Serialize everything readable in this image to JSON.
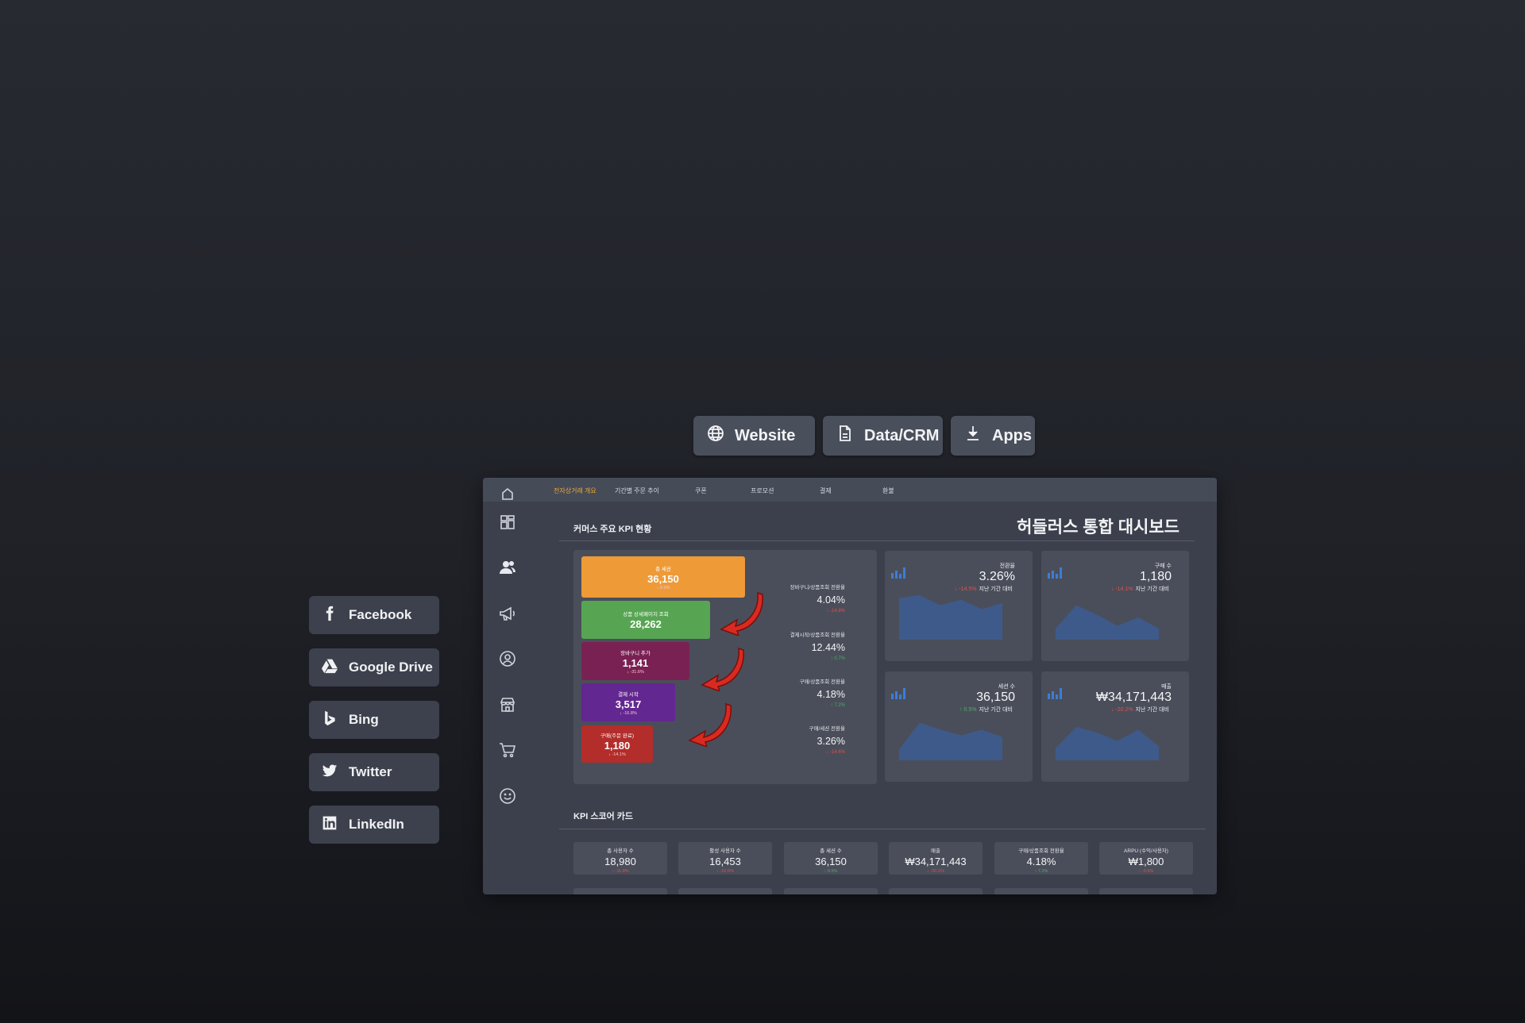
{
  "source_buttons": [
    {
      "label": "Website",
      "icon": "globe-icon"
    },
    {
      "label": "Data/CRM",
      "icon": "document-icon"
    },
    {
      "label": "Apps",
      "icon": "download-icon"
    }
  ],
  "share_buttons": [
    {
      "label": "Facebook",
      "icon": "facebook-icon"
    },
    {
      "label": "Google Drive",
      "icon": "google-drive-icon"
    },
    {
      "label": "Bing",
      "icon": "bing-icon"
    },
    {
      "label": "Twitter",
      "icon": "twitter-icon"
    },
    {
      "label": "LinkedIn",
      "icon": "linkedin-icon"
    }
  ],
  "dashboard": {
    "title": "허들러스 통합 대시보드",
    "top_tabs": [
      "전자상거래 개요",
      "기간별 주문 추이",
      "쿠폰",
      "프로모션",
      "결제",
      "환불"
    ],
    "active_tab": "전자상거래 개요",
    "kpi_section_title": "커머스 주요 KPI 현황",
    "funnel": [
      {
        "label": "총 세션",
        "value": "36,150",
        "delta": "↓ 0.5%",
        "color": "#ee9a37"
      },
      {
        "label": "상품 상세페이지 조회",
        "value": "28,262",
        "delta": "",
        "color": "#57a553"
      },
      {
        "label": "장바구니 추가",
        "value": "1,141",
        "delta": "↓ -31.6%",
        "color": "#7a2153"
      },
      {
        "label": "결제 시작",
        "value": "3,517",
        "delta": "↓ -16.8%",
        "color": "#632791"
      },
      {
        "label": "구매(주문 완료)",
        "value": "1,180",
        "delta": "↓ -14.1%",
        "color": "#b32d2b"
      }
    ],
    "rates": [
      {
        "label": "장바구니/상품조회 전환율",
        "value": "4.04%",
        "delta": "↓ -14.8%",
        "trend": "neg"
      },
      {
        "label": "결제시작/상품조회 전환율",
        "value": "12.44%",
        "delta": "↑ 0.7%",
        "trend": "pos"
      },
      {
        "label": "구매/상품조회 전환율",
        "value": "4.18%",
        "delta": "↑ 7.2%",
        "trend": "pos"
      },
      {
        "label": "구매/세션 전환율",
        "value": "3.26%",
        "delta": "↓ -14.6%",
        "trend": "neg"
      }
    ],
    "kpi_cards": [
      {
        "label": "전환율",
        "value": "3.26%",
        "delta": "↓ -14.5%",
        "trend": "neg",
        "sub": "지난 기간 대비",
        "series": [
          0.75,
          0.8,
          0.62,
          0.72,
          0.55,
          0.66
        ]
      },
      {
        "label": "구매 수",
        "value": "1,180",
        "delta": "↓ -14.1%",
        "trend": "neg",
        "sub": "지난 기간 대비",
        "series": [
          0.2,
          0.62,
          0.45,
          0.25,
          0.4,
          0.2
        ]
      },
      {
        "label": "세션 수",
        "value": "36,150",
        "delta": "↑ 0.5%",
        "trend": "pos",
        "sub": "지난 기간 대비",
        "series": [
          0.2,
          0.68,
          0.55,
          0.45,
          0.55,
          0.42
        ]
      },
      {
        "label": "매출",
        "value": "₩34,171,443",
        "delta": "↓ -20.2%",
        "trend": "neg",
        "sub": "지난 기간 대비",
        "series": [
          0.22,
          0.6,
          0.5,
          0.35,
          0.55,
          0.25
        ]
      }
    ],
    "score_section_title": "KPI 스코어 카드",
    "score_cards": [
      {
        "label": "총 사용자 수",
        "value": "18,980",
        "delta": "↓ -11.8%",
        "trend": "neg"
      },
      {
        "label": "활성 사용자 수",
        "value": "16,453",
        "delta": "↓ -10.6%",
        "trend": "neg"
      },
      {
        "label": "총 세션 수",
        "value": "36,150",
        "delta": "↑ 0.5%",
        "trend": "pos"
      },
      {
        "label": "매출",
        "value": "₩34,171,443",
        "delta": "↓ -20.2%",
        "trend": "neg"
      },
      {
        "label": "구매/상품조회 전환율",
        "value": "4.18%",
        "delta": "↑ 7.2%",
        "trend": "pos"
      },
      {
        "label": "ARPU (수익/사용자)",
        "value": "₩1,800",
        "delta": "↓ -9.5%",
        "trend": "neg"
      }
    ],
    "sidebar_icons": [
      "home-icon",
      "dashboard-grid-icon",
      "users-icon",
      "megaphone-icon",
      "user-circle-icon",
      "store-icon",
      "cart-icon",
      "smile-icon"
    ]
  },
  "colors": {
    "accent": "#f0a836",
    "negative": "#e0504b",
    "positive": "#4caf63",
    "area_fill": "#3e5a8a",
    "bar_icon": "#3b7dd8"
  }
}
